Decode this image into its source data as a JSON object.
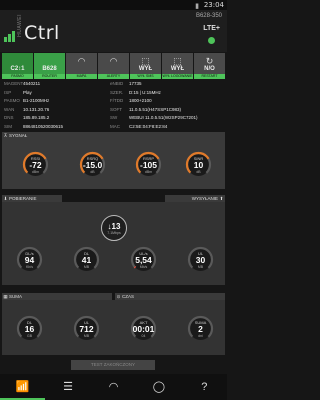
{
  "status": {
    "time": "23:04",
    "battery_icon": "battery-icon"
  },
  "header": {
    "brand_sub": "HUAWEI",
    "brand": "Ctrl",
    "device": "B628-350",
    "net": "LTE+"
  },
  "tabs": [
    {
      "top": "C2↕1",
      "icon": "signal-bars-icon",
      "cap": "PASMO"
    },
    {
      "top": "B628",
      "icon": "router-icon",
      "cap": "ROUTER"
    },
    {
      "top": "",
      "icon": "wifi-icon",
      "cap": "MAPA"
    },
    {
      "top": "",
      "icon": "wifi-icon",
      "cap": "ALERTY"
    },
    {
      "top": "WYŁ",
      "icon": "lock-icon",
      "cap": "WYŁ SMS"
    },
    {
      "top": "WYŁ",
      "icon": "lock-icon",
      "cap": "WYŁ LOGOWANIE"
    },
    {
      "top": "N/O",
      "icon": "refresh-icon",
      "cap": "RESTART"
    }
  ],
  "info": {
    "rows": [
      [
        {
          "k": "MAGENT",
          "v": "4540211"
        },
        {
          "k": "eNBID",
          "v": "17735"
        }
      ],
      [
        {
          "k": "ISP",
          "v": "Play"
        },
        {
          "k": "SZER.",
          "v": "D:15 | U:15MHz"
        }
      ],
      [
        {
          "k": "PASMO",
          "v": "B1-2100MHz"
        },
        {
          "k": "F/TDD",
          "v": "1800+2100"
        }
      ],
      [
        {
          "k": "WAN",
          "v": "10.131.20.76"
        },
        {
          "k": "SOFT",
          "v": "11.0.5.51(H47SSP1C983)"
        }
      ],
      [
        {
          "k": "DNS",
          "v": "185.89.185.2"
        },
        {
          "k": "SW",
          "v": "WEBUI 11.0.5.51(W2SP29C7201)"
        }
      ],
      [
        {
          "k": "SIM",
          "v": "8864810520030615"
        },
        {
          "k": "MAC",
          "v": "C2:5E:04:F8:E2:84"
        }
      ]
    ]
  },
  "sections": {
    "signal": "SYGNAŁ",
    "download": "POBIERANIE",
    "upload": "WYSYŁANIE",
    "sum": "SUMA",
    "time": "CZAS"
  },
  "signal": [
    {
      "label": "RSSI",
      "value": "-72",
      "unit": "dBm",
      "pct": 0.72,
      "color": "#e07a2a"
    },
    {
      "label": "RSRQ",
      "value": "-15.0",
      "unit": "dB",
      "pct": 0.72,
      "color": "#e07a2a"
    },
    {
      "label": "RSRP",
      "value": "-105",
      "unit": "dBm",
      "pct": 0.72,
      "color": "#e07a2a"
    },
    {
      "label": "SINR",
      "value": "10",
      "unit": "dB",
      "pct": 0.72,
      "color": "#e07a2a"
    }
  ],
  "speed": {
    "value": "↓13",
    "unit": "7.1Mbps"
  },
  "traffic": [
    {
      "label": "DL/s",
      "value": "94",
      "unit": "Kb/s",
      "pct": 0.0,
      "color": "#888"
    },
    {
      "label": "DL",
      "value": "41",
      "unit": "MB",
      "pct": 0.0,
      "color": "#888"
    },
    {
      "label": "UL/s",
      "value": "5,54",
      "unit": "Mb/s",
      "pct": 0.02,
      "color": "#e84a3a"
    },
    {
      "label": "UL",
      "value": "30",
      "unit": "MB",
      "pct": 0.0,
      "color": "#888"
    }
  ],
  "totals": [
    {
      "label": "DL",
      "value": "16",
      "unit": "GB",
      "pct": 0.0,
      "color": "#888"
    },
    {
      "label": "UL",
      "value": "712",
      "unit": "MB",
      "pct": 0.0,
      "color": "#888"
    },
    {
      "label": "AKT",
      "value": "00:01",
      "unit": "04",
      "pct": 0.0,
      "color": "#888"
    },
    {
      "label": "SUMA",
      "value": "2",
      "unit": "dni",
      "pct": 0.0,
      "color": "#888"
    }
  ],
  "test_button": "TEST ZAKOŃCZONY",
  "nav": [
    "signal-home-icon",
    "sliders-icon",
    "wifi-icon",
    "chat-icon",
    "help-icon"
  ]
}
